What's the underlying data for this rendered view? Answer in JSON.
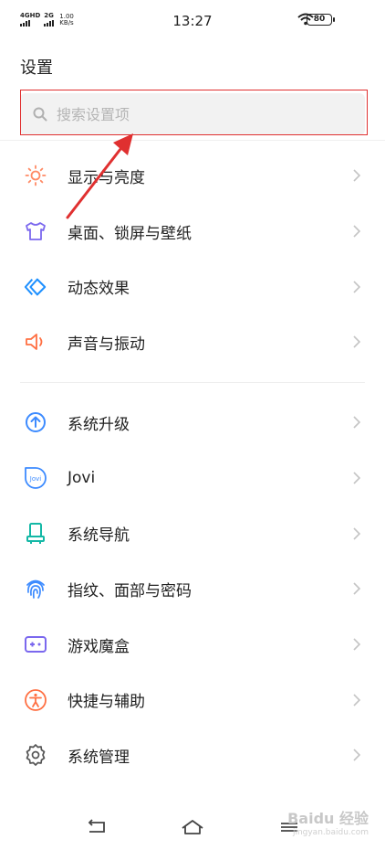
{
  "status_bar": {
    "net1": "4GHD",
    "net2": "2G",
    "speed_value": "1.00",
    "speed_unit": "KB/s",
    "time": "13:27",
    "battery": "80"
  },
  "header": {
    "title": "设置"
  },
  "search": {
    "placeholder": "搜索设置项"
  },
  "groups": [
    {
      "items": [
        {
          "label": "显示与亮度",
          "icon": "sun-icon",
          "color": "#ff8a65"
        },
        {
          "label": "桌面、锁屏与壁纸",
          "icon": "shirt-icon",
          "color": "#7b68ee"
        },
        {
          "label": "动态效果",
          "icon": "diamond-icon",
          "color": "#1e90ff"
        },
        {
          "label": "声音与振动",
          "icon": "speaker-icon",
          "color": "#ff7043"
        }
      ]
    },
    {
      "items": [
        {
          "label": "系统升级",
          "icon": "upgrade-arrow-icon",
          "color": "#3d8bff"
        },
        {
          "label": "Jovi",
          "icon": "jovi-icon",
          "color": "#3d8bff"
        },
        {
          "label": "系统导航",
          "icon": "navigation-icon",
          "color": "#14b8a6"
        },
        {
          "label": "指纹、面部与密码",
          "icon": "fingerprint-icon",
          "color": "#3d8bff"
        },
        {
          "label": "游戏魔盒",
          "icon": "game-box-icon",
          "color": "#7b68ee"
        },
        {
          "label": "快捷与辅助",
          "icon": "accessibility-icon",
          "color": "#ff7043"
        },
        {
          "label": "系统管理",
          "icon": "gear-icon",
          "color": "#555555"
        }
      ]
    }
  ],
  "watermark": {
    "text": "Baidu 经验",
    "sub": "jingyan.baidu.com"
  },
  "colors": {
    "annotation": "#e03030",
    "chevron": "#c4c4c4"
  }
}
